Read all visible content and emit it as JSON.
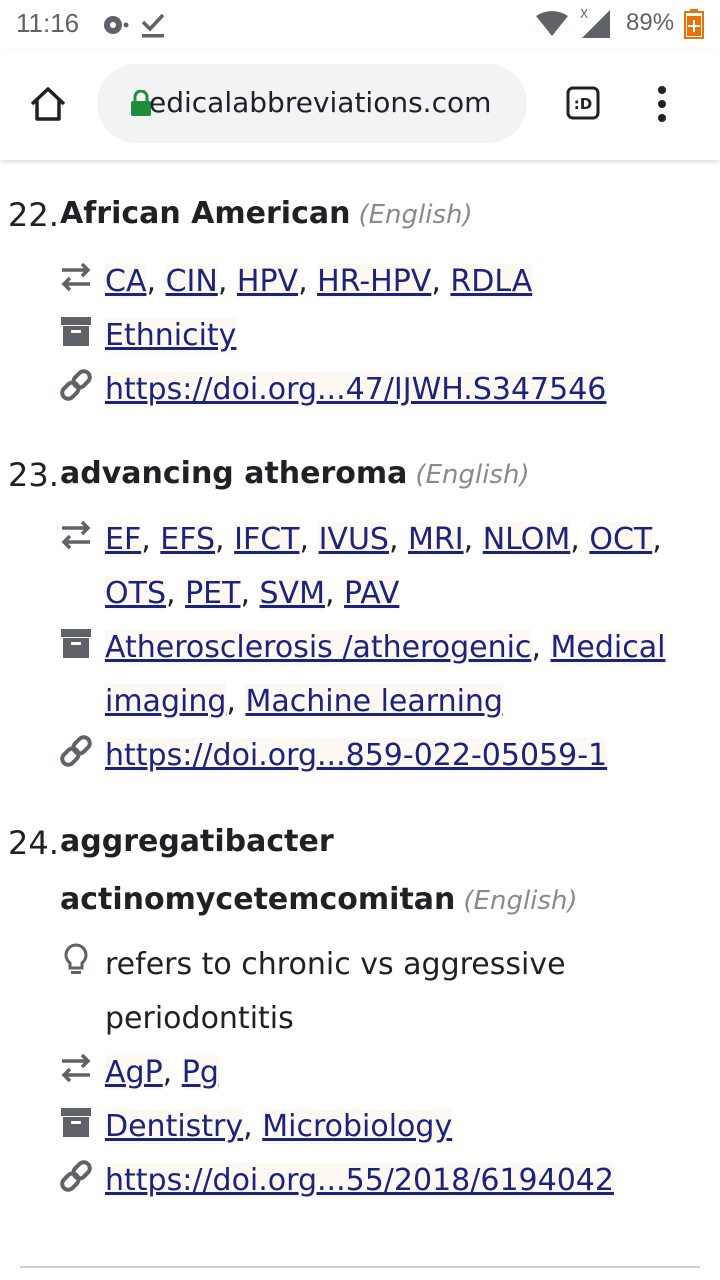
{
  "status": {
    "time": "11:16",
    "battery": "89%"
  },
  "browser": {
    "url": "edicalabbreviations.com",
    "tab_count": ":D"
  },
  "entries": [
    {
      "num": "22.",
      "term": "African American",
      "lang": "(English)",
      "abbrevs": [
        "CA",
        "CIN",
        "HPV",
        "HR-HPV",
        "RDLA"
      ],
      "categories": [
        "Ethnicity"
      ],
      "link": "https://doi.org...47/IJWH.S347546"
    },
    {
      "num": "23.",
      "term": "advancing atheroma",
      "lang": "(English)",
      "abbrevs": [
        "EF",
        "EFS",
        "IFCT",
        "IVUS",
        "MRI",
        "NLOM",
        "OCT",
        "OTS",
        "PET",
        "SVM",
        "PAV"
      ],
      "categories": [
        "Atherosclerosis /atherogenic",
        "Medical imaging",
        "Machine learning"
      ],
      "link": "https://doi.org...859-022-05059-1"
    },
    {
      "num": "24.",
      "term_line1": "aggregatibacter",
      "term_line2": "actinomycetemcomitan",
      "lang": "(English)",
      "note": "refers to chronic vs aggressive periodontitis",
      "abbrevs": [
        "AgP",
        "Pg"
      ],
      "categories": [
        "Dentistry",
        "Microbiology"
      ],
      "link": "https://doi.org...55/2018/6194042"
    }
  ]
}
